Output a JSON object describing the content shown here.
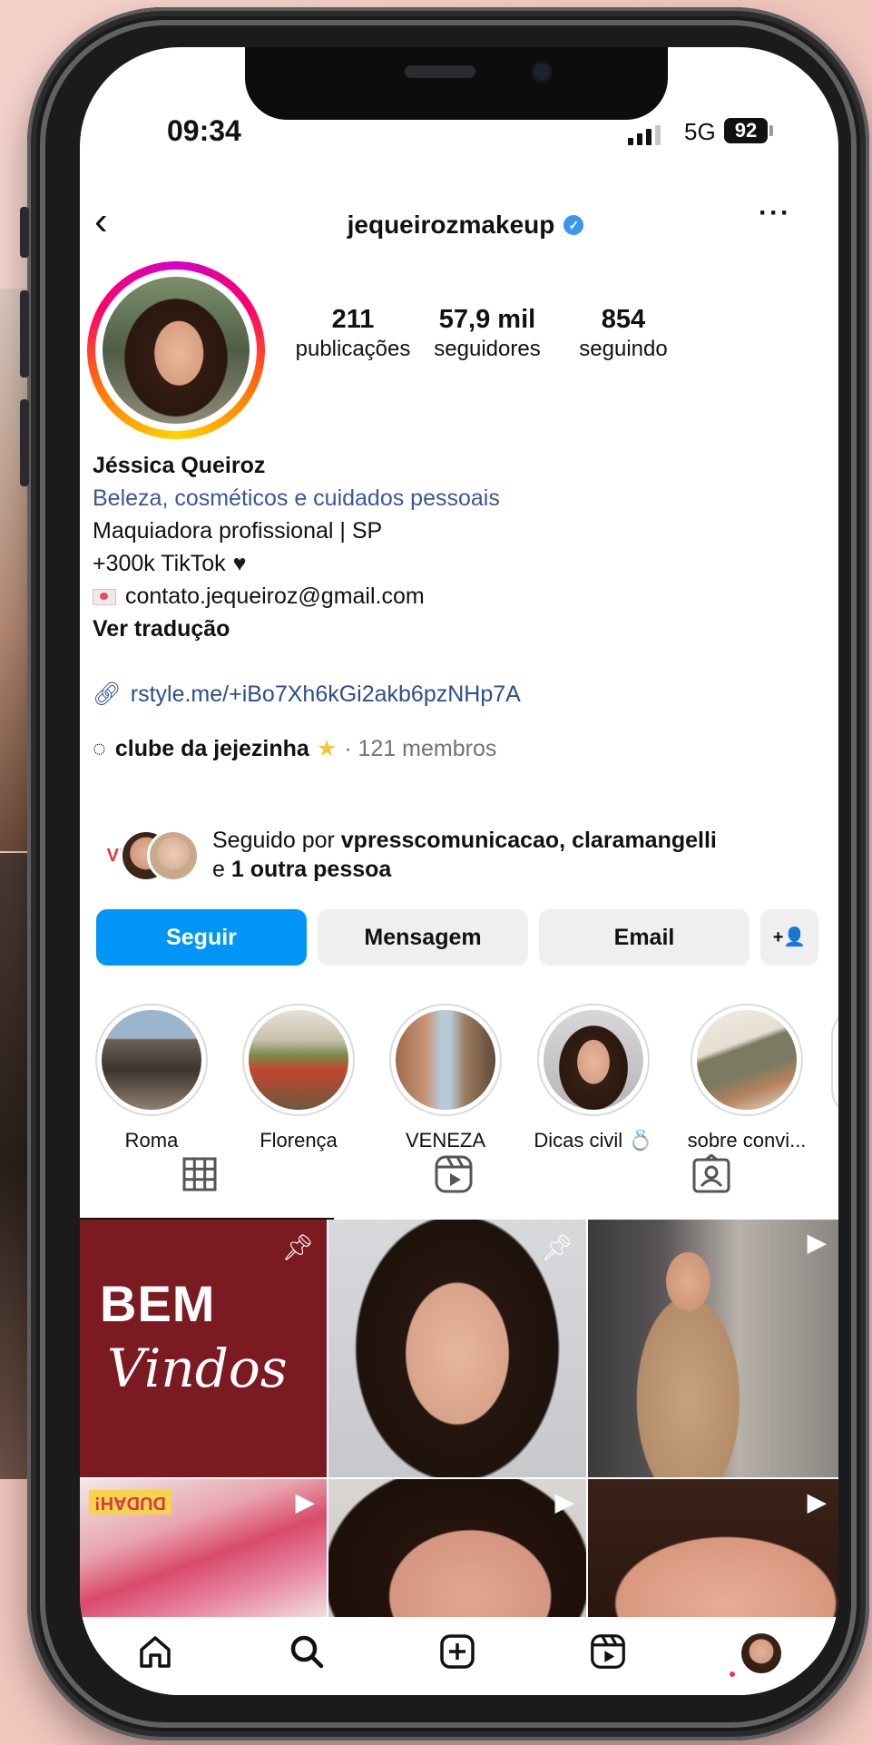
{
  "status": {
    "time": "09:34",
    "network": "5G",
    "battery": "92"
  },
  "header": {
    "username": "jequeirozmakeup",
    "more": "···",
    "back": "‹"
  },
  "stats": [
    {
      "value": "211",
      "label": "publicações"
    },
    {
      "value": "57,9 mil",
      "label": "seguidores"
    },
    {
      "value": "854",
      "label": "seguindo"
    }
  ],
  "bio": {
    "name": "Jéssica Queiroz",
    "category": "Beleza, cosméticos e cuidados pessoais",
    "line1": "Maquiadora profissional | SP",
    "line2": "+300k TikTok",
    "email": "contato.jequeiroz@gmail.com",
    "translate": "Ver tradução",
    "link": "rstyle.me/+iBo7Xh6kGi2akb6pzNHp7A",
    "channel": "clube da jejezinha",
    "channel_members": "· 121 membros",
    "followed_prefix": "Seguido por ",
    "followed_names": "vpresscomunicacao, claramangelli",
    "followed_and": "e ",
    "followed_more": "1 outra pessoa"
  },
  "actions": {
    "follow": "Seguir",
    "message": "Mensagem",
    "email": "Email",
    "add_person": "+👤"
  },
  "highlights": [
    {
      "label": "Roma"
    },
    {
      "label": "Florença"
    },
    {
      "label": "VENEZA"
    },
    {
      "label": "Dicas civil 💍"
    },
    {
      "label": "sobre convi..."
    }
  ],
  "grid": {
    "tile1_line1": "BEM",
    "tile1_line2": "Vindos",
    "tile4_label": "DUDAH!"
  },
  "icons": {
    "grid_tab": "grid-icon",
    "reels_tab": "reels-icon",
    "tagged_tab": "tagged-icon",
    "home": "home-icon",
    "search": "search-icon",
    "create": "create-icon",
    "reels": "reels-icon",
    "profile": "profile-avatar"
  }
}
